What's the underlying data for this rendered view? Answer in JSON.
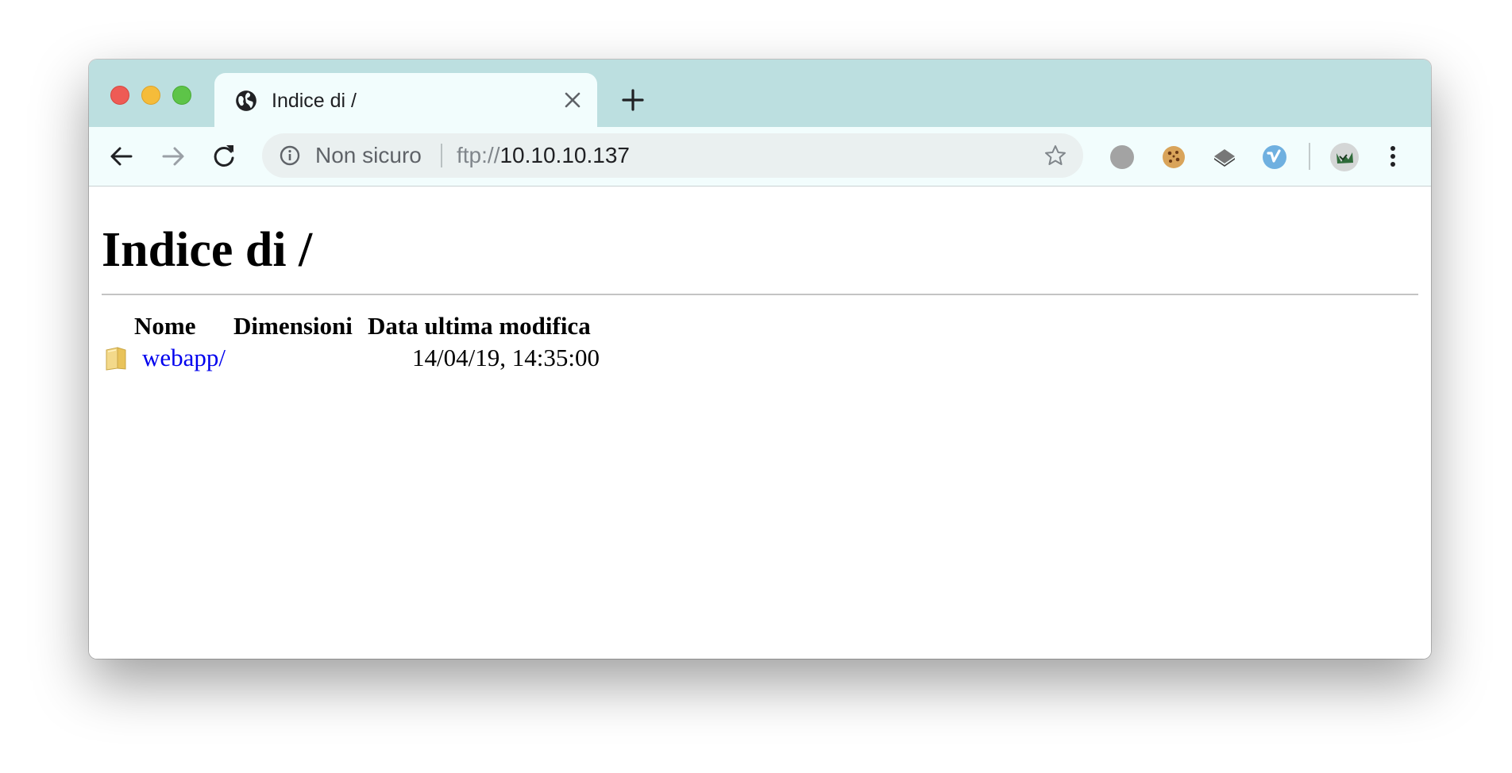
{
  "browser": {
    "tab": {
      "title": "Indice di /",
      "icon": "globe-icon"
    },
    "toolbar": {
      "security_label": "Non sicuro",
      "url_scheme": "ftp://",
      "url_host": "10.10.10.137",
      "extensions": [
        "gray-circle-extension-icon",
        "cookie-extension-icon",
        "layers-extension-icon",
        "vimeo-extension-icon"
      ],
      "profile_icon": "profile-avatar-icon"
    },
    "colors": {
      "titlebar": "#bcdfe0",
      "tab": "#f2fdfd",
      "link": "#0000ee"
    }
  },
  "page": {
    "heading": "Indice di /",
    "columns": [
      "Nome",
      "Dimensioni",
      "Data ultima modifica"
    ],
    "rows": [
      {
        "name": "webapp/",
        "size": "",
        "modified": "14/04/19, 14:35:00",
        "icon": "folder-icon"
      }
    ]
  }
}
